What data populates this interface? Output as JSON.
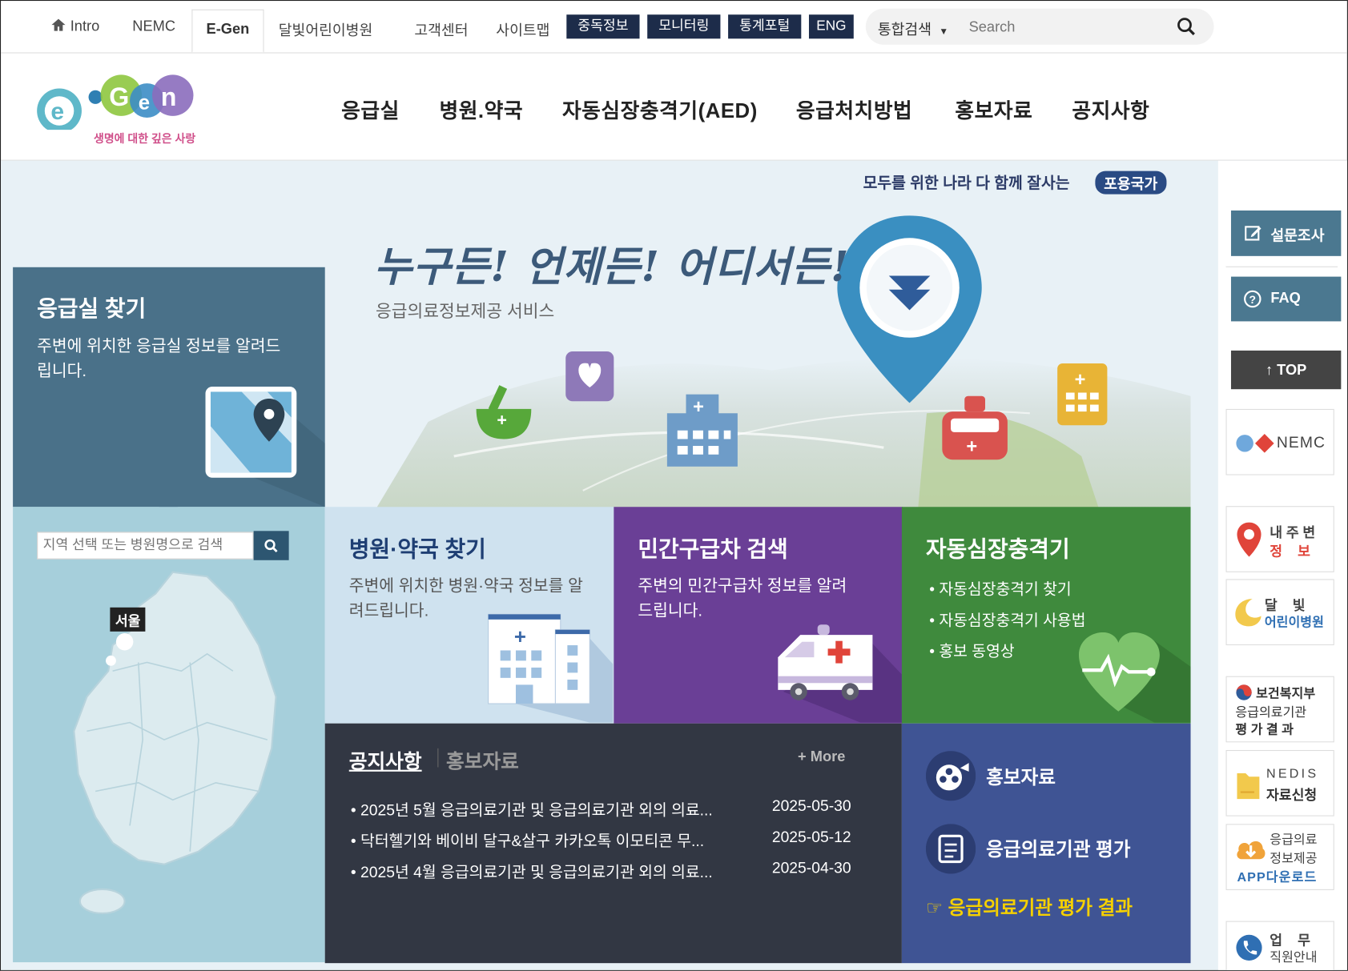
{
  "topbar": {
    "intro": "Intro",
    "nemc": "NEMC",
    "egen": "E-Gen",
    "moonlight": "달빛어린이병원",
    "customer": "고객센터",
    "sitemap": "사이트맵",
    "addiction": "중독정보",
    "monitoring": "모니터링",
    "stats": "통계포털",
    "eng": "ENG",
    "search_scope": "통합검색",
    "search_placeholder": "Search"
  },
  "logo": {
    "tagline": "생명에 대한 깊은 사랑"
  },
  "gnb": [
    "응급실",
    "병원.약국",
    "자동심장충격기(AED)",
    "응급처치방법",
    "홍보자료",
    "공지사항"
  ],
  "hero": {
    "slogan": "모두를 위한 나라 다 함께 잘사는",
    "slogan_badge": "포용국가",
    "title": "누구든! 언제든! 어디서든!",
    "subtitle": "응급의료정보제공 서비스"
  },
  "er": {
    "title": "응급실 찾기",
    "desc": "주변에 위치한 응급실 정보를 알려드립니다.",
    "search_placeholder": "지역 선택 또는 병원명으로 검색",
    "region_seoul": "서울"
  },
  "tiles": {
    "hospital": {
      "title": "병원·약국 찾기",
      "desc": "주변에 위치한 병원·약국 정보를 알려드립니다."
    },
    "ambulance": {
      "title": "민간구급차 검색",
      "desc": "주변의 민간구급차 정보를 알려드립니다."
    },
    "aed": {
      "title": "자동심장충격기",
      "items": [
        "자동심장충격기 찾기",
        "자동심장충격기 사용법",
        "홍보 동영상"
      ]
    }
  },
  "notice": {
    "tab_notice": "공지사항",
    "tab_promo": "홍보자료",
    "more": "+ More",
    "items": [
      {
        "title": "2025년 5월 응급의료기관 및 응급의료기관 외의 의료...",
        "date": "2025-05-30"
      },
      {
        "title": "닥터헬기와 베이비 달구&살구 카카오톡 이모티콘 무...",
        "date": "2025-05-12"
      },
      {
        "title": "2025년 4월 응급의료기관 및 응급의료기관 외의 의료...",
        "date": "2025-04-30"
      }
    ]
  },
  "promo": {
    "promo_label": "홍보자료",
    "eval_label": "응급의료기관 평가",
    "eval_result": "☞ 응급의료기관 평가 결과"
  },
  "sidebar": {
    "survey": "설문조사",
    "faq": "FAQ",
    "top": "↑ TOP",
    "nemc": "NEMC",
    "nearby_1": "내 주 변",
    "nearby_2": "정    보",
    "moon_1": "달    빛",
    "moon_2": "어린이병원",
    "mohw_1": "보건복지부",
    "mohw_2": "응급의료기관",
    "mohw_3": "평 가 결 과",
    "nedis_1": "NEDIS",
    "nedis_2": "자료신청",
    "app_1": "응급의료",
    "app_2": "정보제공",
    "app_3": "APP다운로드",
    "staff_1": "업    무",
    "staff_2": "직원안내"
  },
  "colors": {
    "navy": "#1d2c4a",
    "er_panel": "#4a7189",
    "map_bg": "#a6cfdb",
    "hospital_tile": "#cfe2ef",
    "ambulance_tile": "#6a3f96",
    "aed_tile": "#3f8a3d",
    "notice_bg": "#323743",
    "promo_bg": "#3f5494",
    "sidebar_btn": "#4b7890"
  }
}
